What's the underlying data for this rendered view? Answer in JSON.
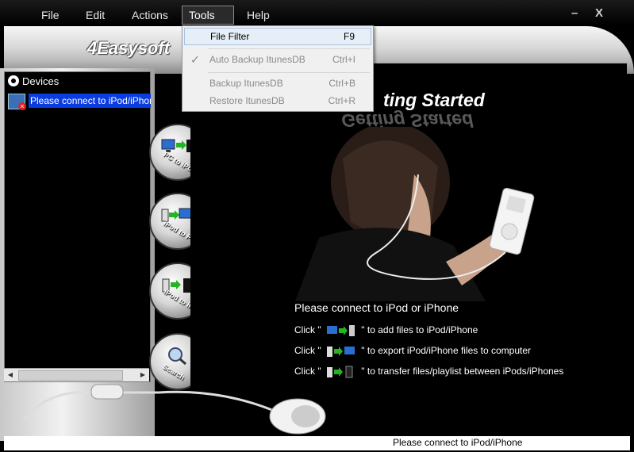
{
  "menu": {
    "file": "File",
    "edit": "Edit",
    "actions": "Actions",
    "tools": "Tools",
    "help": "Help",
    "minimize": "–",
    "close": "X"
  },
  "logo": "4Easysoft",
  "devices": {
    "header": "Devices",
    "item": "Please connect to iPod/iPhone"
  },
  "nav": {
    "pc_to_ipod": "PC to iPod",
    "ipod_to_pc": "iPod to PC",
    "ipod_to_ipod": "iPod to iPod",
    "search": "Search"
  },
  "main": {
    "title": "Getting Started",
    "title_visible": "ting Started",
    "connect": "Please connect to iPod or iPhone",
    "instructions": [
      {
        "prefix": "Click \"",
        "suffix": "\" to add files to iPod/iPhone"
      },
      {
        "prefix": "Click \"",
        "suffix": "\" to export iPod/iPhone files to computer"
      },
      {
        "prefix": "Click \"",
        "suffix": "\" to transfer files/playlist between iPods/iPhones"
      }
    ]
  },
  "tools_menu": {
    "items": [
      {
        "label": "File Filter",
        "shortcut": "F9"
      },
      {
        "label": "Auto Backup ItunesDB",
        "shortcut": "Ctrl+I"
      },
      {
        "label": "Backup ItunesDB",
        "shortcut": "Ctrl+B"
      },
      {
        "label": "Restore ItunesDB",
        "shortcut": "Ctrl+R"
      }
    ]
  },
  "status": "Please connect to iPod/iPhone",
  "colors": {
    "selection": "#0a3ce0",
    "background": "#000000",
    "menu_bg": "#f0f0f0"
  }
}
